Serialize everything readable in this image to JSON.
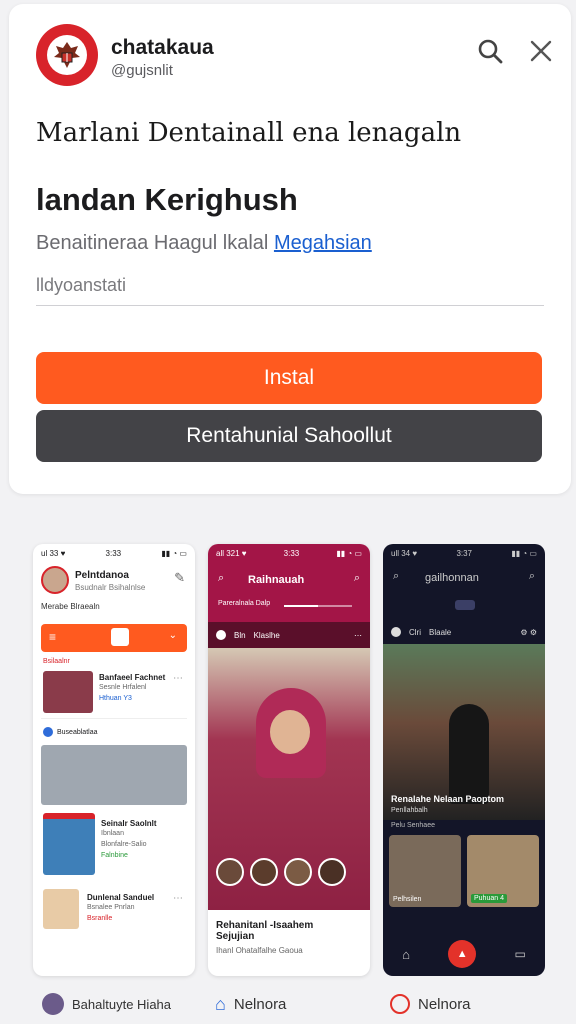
{
  "header": {
    "app_name": "chatakaua",
    "app_handle": "@gujsnlit",
    "search_icon": "search-icon",
    "close_icon": "close-icon"
  },
  "tagline": "Marlani Dentainall ena lenagaln",
  "title": "landan Kerighush",
  "subtitle": {
    "text": "Benaitineraa Haagul lkalal",
    "link": "Megahsian"
  },
  "input": {
    "placeholder": "lldyoanstati"
  },
  "buttons": {
    "install": "Instal",
    "secondary": "Rentahunial Sahoollut"
  },
  "colors": {
    "accent": "#ff5a1f",
    "crimson": "#a31547",
    "dark": "#434347",
    "link": "#1a5fd0"
  },
  "screenshots": {
    "phone1": {
      "status_time": "3:33",
      "status_left": "ul 33 ♥",
      "profile_name": "Pelntdanoa",
      "profile_sub": "Bsudnalr Bsihalnlse",
      "tabs": "Merabe Blraealn",
      "band_sub": "Bsilaalnr",
      "item1_title": "Banfaeel Fachnet",
      "item1_sub": "Sesnle Hrfalenl",
      "item1_meta": "Hthuan Y3",
      "tag": "Buseablatlaa",
      "item2_title": "Seinalr Saolnlt",
      "item2_sub": "Ibnlaan",
      "item2_line2": "Blonfalre-Salio",
      "item2_meta": "Falnbine",
      "item3_title": "Dunlenal Sanduel",
      "item3_sub": "Bsnalee Pnrlan",
      "item3_meta": "Bsranlle"
    },
    "phone2": {
      "status_time": "3:33",
      "status_left": "all 321 ♥",
      "header_title": "Raihnauah",
      "progress_label": "Pareralnala Dalp",
      "progress": 0.5,
      "tab1": "Bln",
      "tab2": "Klaslhe",
      "caption_title": "Rehanitanl -Isaahem",
      "caption_title2": "Sejujian",
      "caption_sub": "Ihanl Ohatalfalhe Gaoua"
    },
    "phone3": {
      "status_time": "3:37",
      "status_left": "ull 34 ♥",
      "header_title": "gailhonnan",
      "tab1": "Clri",
      "tab2": "Blaale",
      "caption_title": "Renalahe Nelaan Paoptom",
      "caption_sub": "Penllahbalh",
      "caption_sub2": "Pelu Senhaee",
      "thumb1_label": "Pelhsilen",
      "thumb2_label": "Puhuan 4"
    },
    "bottom": [
      {
        "label": "Bahaltuyte Hiaha"
      },
      {
        "label": "Nelnora"
      },
      {
        "label": "Nelnora"
      }
    ]
  }
}
